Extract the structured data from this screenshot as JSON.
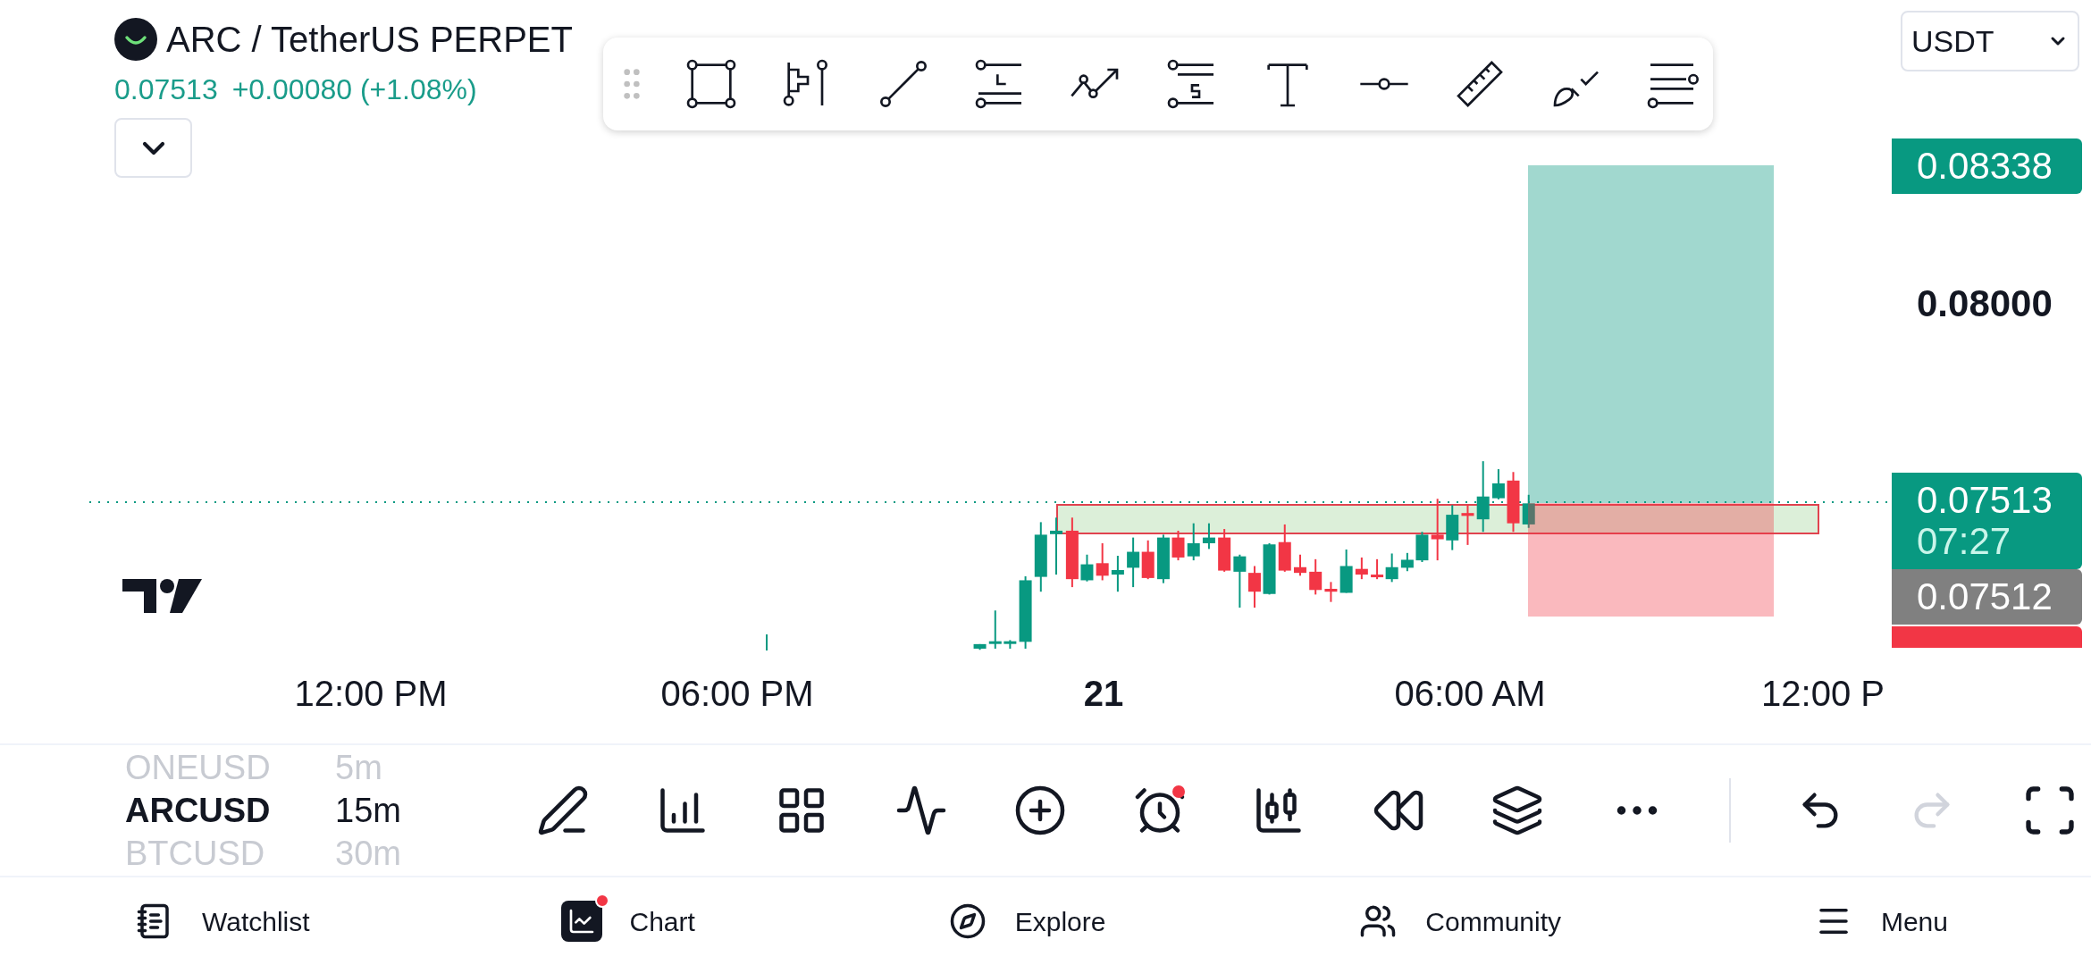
{
  "header": {
    "title": "ARC / TetherUS PERPET",
    "price": "0.07513",
    "change": "+0.00080 (+1.08%)",
    "currency": "USDT"
  },
  "price_axis": [
    {
      "kind": "badge",
      "color": "#089981",
      "text": "0.08338"
    },
    {
      "kind": "tick",
      "text": "0.08000"
    },
    {
      "kind": "badge",
      "color": "#089981",
      "text": "0.07513",
      "subtext": "07:27"
    },
    {
      "kind": "badge",
      "color": "#808080",
      "text": "0.07512"
    },
    {
      "kind": "strip",
      "color": "#f23645"
    }
  ],
  "time_axis": [
    {
      "kind": "time",
      "text": "12:00 PM"
    },
    {
      "kind": "time",
      "text": "06:00 PM"
    },
    {
      "kind": "day",
      "text": "21"
    },
    {
      "kind": "time",
      "text": "06:00 AM"
    },
    {
      "kind": "time",
      "text": "12:00 P"
    }
  ],
  "symbols": [
    {
      "symbol": "ONEUSD",
      "interval": "5m",
      "selected": false
    },
    {
      "symbol": "ARCUSD",
      "interval": "15m",
      "selected": true
    },
    {
      "symbol": "BTCUSD",
      "interval": "30m",
      "selected": false
    }
  ],
  "chart_toolbar": {
    "alarm_badge": true,
    "redo_disabled": true
  },
  "nav": [
    {
      "label": "Watchlist",
      "selected": false,
      "badge": false
    },
    {
      "label": "Chart",
      "selected": true,
      "badge": true
    },
    {
      "label": "Explore",
      "selected": false,
      "badge": false
    },
    {
      "label": "Community",
      "selected": false,
      "badge": false
    },
    {
      "label": "Menu",
      "selected": false,
      "badge": false
    }
  ]
}
